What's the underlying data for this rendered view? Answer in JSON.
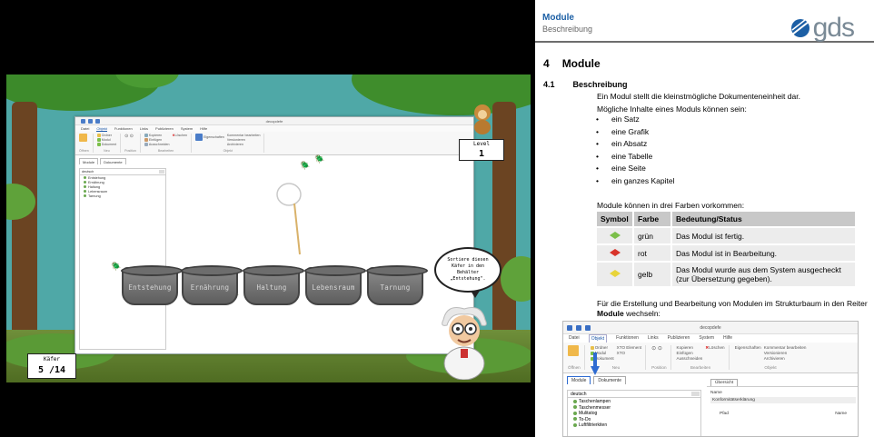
{
  "game": {
    "app_window_title": "decopdefe",
    "menu": [
      "Datei",
      "Objekt",
      "Funktionen",
      "Links",
      "Publizieren",
      "System",
      "Hilfe"
    ],
    "ribbon_groups": [
      "Öffnen",
      "Neu",
      "Position",
      "Bearbeiten",
      "Objekt"
    ],
    "ribbon_items": {
      "neu": [
        "Ordner",
        "Modul",
        "Dokument"
      ],
      "bearbeiten": [
        "Kopieren",
        "Einfügen",
        "Ausschneiden",
        "Löschen"
      ],
      "objekt": [
        "Eigenschaften",
        "Kommentar bearbeiten",
        "Versionieren",
        "Archivieren"
      ]
    },
    "tabs": [
      "Module",
      "Dokumente"
    ],
    "language_select": "deutsch",
    "tree": [
      "Entstehung",
      "Ernährung",
      "Haltung",
      "Lebensraum",
      "Tarnung"
    ],
    "level_label": "Level",
    "level_value": "1",
    "kaefer_label": "Käfer",
    "kaefer_value": "5 /14",
    "speech": "Sortiere diesen Käfer in den Behälter „Entstehung\".",
    "pots": [
      "Entstehung",
      "Ernährung",
      "Haltung",
      "Lebensraum",
      "Tarnung"
    ]
  },
  "doc": {
    "header_title": "Module",
    "header_subtitle": "Beschreibung",
    "logo_text": "gds",
    "section_num": "4",
    "section_title": "Module",
    "sub_num": "4.1",
    "sub_title": "Beschreibung",
    "p1": "Ein Modul stellt die kleinstmögliche Dokumenteneinheit dar.",
    "p2": "Mögliche Inhalte eines Moduls können sein:",
    "bullets": [
      "ein Satz",
      "eine Grafik",
      "ein Absatz",
      "eine Tabelle",
      "eine Seite",
      "ein ganzes Kapitel"
    ],
    "p3": "Module können in drei Farben vorkommen:",
    "table": {
      "headers": [
        "Symbol",
        "Farbe",
        "Bedeutung/Status"
      ],
      "rows": [
        {
          "color": "grün",
          "hex": "#7bbf4a",
          "meaning": "Das Modul ist fertig."
        },
        {
          "color": "rot",
          "hex": "#d8332a",
          "meaning": "Das Modul ist in Bearbeitung."
        },
        {
          "color": "gelb",
          "hex": "#e8d43a",
          "meaning": "Das Modul wurde aus dem System ausgecheckt (zur Übersetzung gegeben)."
        }
      ]
    },
    "p4_a": "Für die Erstellung und Bearbeitung von Modulen im Strukturbaum in den Reiter ",
    "p4_b": "Module",
    "p4_c": " wechseln:",
    "shot": {
      "title": "decopdefe",
      "menu": [
        "Datei",
        "Objekt",
        "Funktionen",
        "Links",
        "Publizieren",
        "System",
        "Hilfe"
      ],
      "ribbon_neu": [
        "Ordner",
        "Modul",
        "Dokument"
      ],
      "ribbon_neu2": [
        "XTO Element",
        "XTO"
      ],
      "ribbon_bearb": [
        "Kopieren",
        "Einfügen",
        "Ausschneiden",
        "Löschen"
      ],
      "ribbon_obj": [
        "Kommentar bearbeiten",
        "Versionieren",
        "Archivieren"
      ],
      "groups": [
        "Öffnen",
        "Neu",
        "Position",
        "Bearbeiten",
        "Objekt"
      ],
      "eigenschaften": "Eigenschaften",
      "tabs": [
        "Module",
        "Dokumente"
      ],
      "lang": "deutsch",
      "tree": [
        "Taschenlampen",
        "Taschenmesser",
        "Mulitatog",
        "To-Do",
        "Luftfiltrierkiten"
      ],
      "uebersicht": "Übersicht",
      "name_label": "Name",
      "name_value": "Konformitätserklärung",
      "col_pfad": "Pfad",
      "col_name": "Name"
    }
  },
  "colors": {
    "sky": "#4fa8a7",
    "doc_blue": "#1c5fa5",
    "beetle": "#3b87c9"
  }
}
